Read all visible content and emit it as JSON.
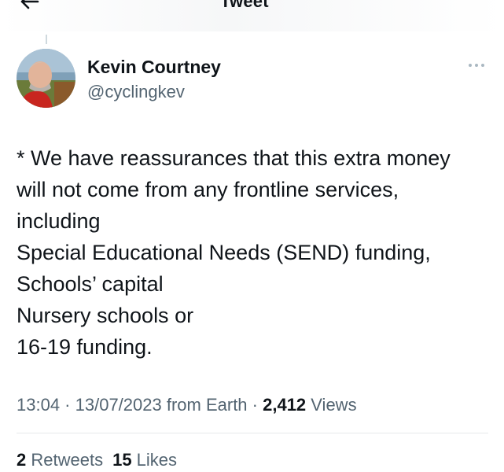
{
  "header": {
    "title": "Tweet",
    "back_icon": "arrow-left-icon"
  },
  "author": {
    "name": "Kevin Courtney",
    "handle": "@cyclingkev",
    "avatar_icon": "profile-photo",
    "more_icon": "more-horizontal-icon"
  },
  "tweet": {
    "lines": [
      "* We have reassurances that this extra money",
      "will not come from any frontline services,",
      "including",
      "Special Educational Needs (SEND) funding,",
      "Schools’ capital",
      "Nursery schools or",
      "16-19 funding."
    ]
  },
  "meta": {
    "time": "13:04",
    "sep1": " · ",
    "date": "13/07/2023",
    "source": " from Earth",
    "sep2": " · ",
    "views_count": "2,412",
    "views_label": " Views"
  },
  "stats": {
    "retweets_count": "2",
    "retweets_label": " Retweets",
    "likes_count": "15",
    "likes_label": " Likes"
  },
  "colors": {
    "text_primary": "#0f1419",
    "text_secondary": "#536471",
    "divider": "#e7e9ea"
  }
}
